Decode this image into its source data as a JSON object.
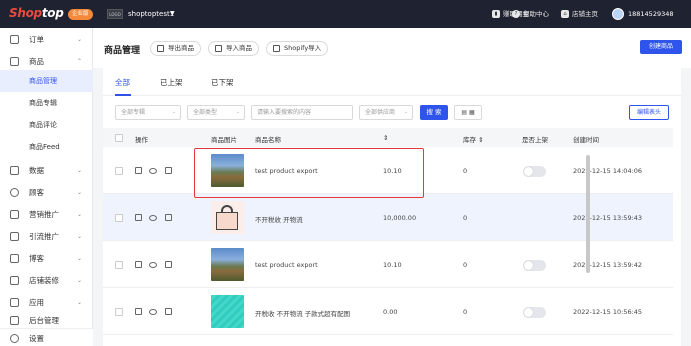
{
  "topbar": {
    "logo_left": "Shop",
    "logo_right": "top",
    "plan_badge": "企业版",
    "store_logo_text": "LOGO",
    "store_name": "shoptoptest1",
    "earn_label": "赚取佣金",
    "help_label": "帮助中心",
    "store_home_label": "店铺主页",
    "phone": "18814529348"
  },
  "sidebar": {
    "items": [
      {
        "label": "订单"
      },
      {
        "label": "商品"
      },
      {
        "label": "商品管理"
      },
      {
        "label": "商品专辑"
      },
      {
        "label": "商品评论"
      },
      {
        "label": "商品Feed"
      },
      {
        "label": "数据"
      },
      {
        "label": "顾客"
      },
      {
        "label": "营销推广"
      },
      {
        "label": "引流推广"
      },
      {
        "label": "博客"
      },
      {
        "label": "店铺装修"
      },
      {
        "label": "应用"
      },
      {
        "label": "后台管理"
      }
    ],
    "settings_label": "设置"
  },
  "header": {
    "title": "商品管理",
    "export_label": "导出商品",
    "import_label": "导入商品",
    "shopify_label": "Shopify导入",
    "create_label": "创建商品"
  },
  "tabs": [
    "全部",
    "已上架",
    "已下架"
  ],
  "filters": {
    "album": "全部专辑",
    "type": "全部类型",
    "search_placeholder": "请输入要搜索的内容",
    "supplier": "全部供应商",
    "search_button": "搜 索",
    "edit_header_button": "编辑表头"
  },
  "table": {
    "headers": [
      "操作",
      "商品图片",
      "商品名称",
      "",
      "库存",
      "是否上架",
      "创建时间"
    ],
    "rows": [
      {
        "name": "test product export",
        "price": "10.10",
        "stock": "0",
        "created": "2022-12-15 14:04:06",
        "image": "landscape"
      },
      {
        "name": "不开税收 开物流",
        "price": "10,000.00",
        "stock": "0",
        "created": "2022-12-15 13:59:43",
        "image": "bag"
      },
      {
        "name": "test product export",
        "price": "10.10",
        "stock": "0",
        "created": "2022-12-15 13:59:42",
        "image": "landscape"
      },
      {
        "name": "开税收 不开物流 子款式超有配图",
        "price": "0.00",
        "stock": "0",
        "created": "2022-12-15 10:56:45",
        "image": "teal"
      }
    ]
  },
  "colors": {
    "accent": "#2f54eb",
    "topbar_bg": "#1f2230",
    "highlight_border": "#e23a3a",
    "logo_red": "#e94b3c",
    "badge_orange": "#f5893a"
  }
}
